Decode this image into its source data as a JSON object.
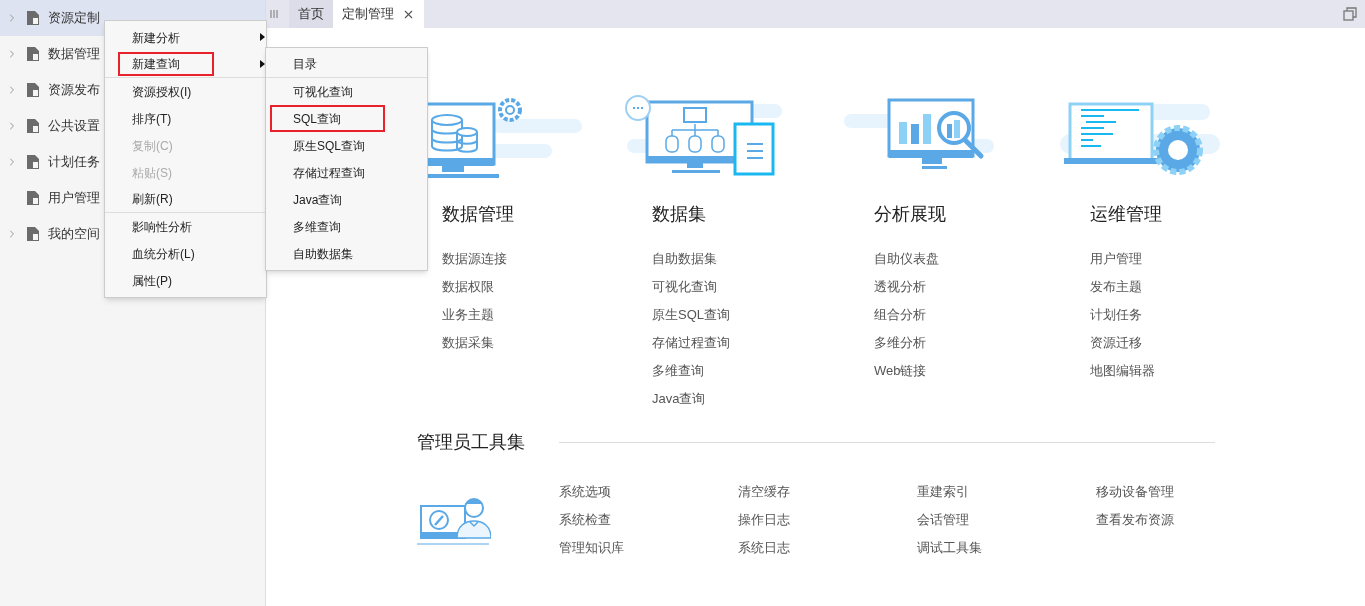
{
  "sidebar": {
    "items": [
      {
        "label": "资源定制",
        "selected": true,
        "expandable": true
      },
      {
        "label": "数据管理",
        "selected": false,
        "expandable": true
      },
      {
        "label": "资源发布",
        "selected": false,
        "expandable": true
      },
      {
        "label": "公共设置",
        "selected": false,
        "expandable": true
      },
      {
        "label": "计划任务",
        "selected": false,
        "expandable": true
      },
      {
        "label": "用户管理",
        "selected": false,
        "expandable": false
      },
      {
        "label": "我的空间",
        "selected": false,
        "expandable": true
      }
    ]
  },
  "tabs": [
    {
      "label": "首页",
      "selected": false,
      "closable": false
    },
    {
      "label": "定制管理",
      "selected": true,
      "closable": true
    }
  ],
  "context_menu": {
    "items": [
      {
        "label": "新建分析",
        "disabled": false,
        "submenu": true,
        "highlighted": false,
        "separator_after": false
      },
      {
        "label": "新建查询",
        "disabled": false,
        "submenu": true,
        "highlighted": true,
        "separator_after": true
      },
      {
        "label": "资源授权(I)",
        "disabled": false,
        "submenu": false,
        "highlighted": false,
        "separator_after": false
      },
      {
        "label": "排序(T)",
        "disabled": false,
        "submenu": false,
        "highlighted": false,
        "separator_after": false
      },
      {
        "label": "复制(C)",
        "disabled": true,
        "submenu": false,
        "highlighted": false,
        "separator_after": false
      },
      {
        "label": "粘贴(S)",
        "disabled": true,
        "submenu": false,
        "highlighted": false,
        "separator_after": false
      },
      {
        "label": "刷新(R)",
        "disabled": false,
        "submenu": false,
        "highlighted": false,
        "separator_after": true
      },
      {
        "label": "影响性分析",
        "disabled": false,
        "submenu": false,
        "highlighted": false,
        "separator_after": false
      },
      {
        "label": "血统分析(L)",
        "disabled": false,
        "submenu": false,
        "highlighted": false,
        "separator_after": false
      },
      {
        "label": "属性(P)",
        "disabled": false,
        "submenu": false,
        "highlighted": false,
        "separator_after": false
      }
    ]
  },
  "submenu": {
    "items": [
      {
        "label": "目录",
        "highlighted": false,
        "separator_after": true
      },
      {
        "label": "可视化查询",
        "highlighted": false,
        "separator_after": false
      },
      {
        "label": "SQL查询",
        "highlighted": true,
        "separator_after": false
      },
      {
        "label": "原生SQL查询",
        "highlighted": false,
        "separator_after": false
      },
      {
        "label": "存储过程查询",
        "highlighted": false,
        "separator_after": false
      },
      {
        "label": "Java查询",
        "highlighted": false,
        "separator_after": false
      },
      {
        "label": "多维查询",
        "highlighted": false,
        "separator_after": false
      },
      {
        "label": "自助数据集",
        "highlighted": false,
        "separator_after": false
      }
    ]
  },
  "sections": [
    {
      "title": "数据管理",
      "kind": "database",
      "links": [
        "数据源连接",
        "数据权限",
        "业务主题",
        "数据采集"
      ]
    },
    {
      "title": "数据集",
      "kind": "dataset",
      "links": [
        "自助数据集",
        "可视化查询",
        "原生SQL查询",
        "存储过程查询",
        "多维查询",
        "Java查询"
      ]
    },
    {
      "title": "分析展现",
      "kind": "analysis",
      "links": [
        "自助仪表盘",
        "透视分析",
        "组合分析",
        "多维分析",
        "Web链接"
      ]
    },
    {
      "title": "运维管理",
      "kind": "operations",
      "links": [
        "用户管理",
        "发布主题",
        "计划任务",
        "资源迁移",
        "地图编辑器"
      ]
    }
  ],
  "admin_tools": {
    "title": "管理员工具集",
    "columns": [
      [
        "系统选项",
        "系统检查",
        "管理知识库"
      ],
      [
        "清空缓存",
        "操作日志",
        "系统日志"
      ],
      [
        "重建索引",
        "会话管理",
        "调试工具集"
      ],
      [
        "移动设备管理",
        "查看发布资源"
      ]
    ]
  }
}
